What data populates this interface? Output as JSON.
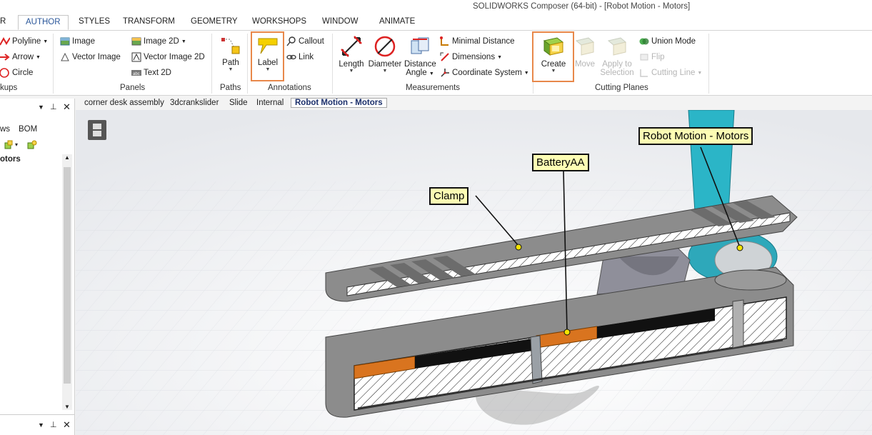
{
  "window": {
    "title": "SOLIDWORKS Composer (64-bit) - [Robot Motion - Motors]"
  },
  "tabs": [
    "R",
    "AUTHOR",
    "STYLES",
    "TRANSFORM",
    "GEOMETRY",
    "WORKSHOPS",
    "WINDOW",
    "ANIMATE"
  ],
  "ribbon": {
    "markups": {
      "polyline": "Polyline",
      "arrow": "Arrow",
      "circle": "Circle",
      "group": "kups"
    },
    "panels": {
      "image": "Image",
      "vector_image": "Vector Image",
      "image_2d": "Image 2D",
      "vector_image_2d": "Vector Image 2D",
      "text_2d": "Text 2D",
      "group": "Panels"
    },
    "paths": {
      "path": "Path",
      "group": "Paths"
    },
    "annotations": {
      "label": "Label",
      "callout": "Callout",
      "link": "Link",
      "group": "Annotations"
    },
    "measurements": {
      "length": "Length",
      "diameter": "Diameter",
      "distance": "Distance",
      "angle": "Angle",
      "minimal_distance": "Minimal Distance",
      "dimensions": "Dimensions",
      "coordinate_system": "Coordinate System",
      "group": "Measurements"
    },
    "cutting": {
      "create": "Create",
      "move": "Move",
      "apply_to": "Apply to",
      "selection": "Selection",
      "union_mode": "Union Mode",
      "flip": "Flip",
      "cutting_line": "Cutting Line",
      "group": "Cutting Planes"
    }
  },
  "doc_tabs": [
    "corner desk assembly",
    "3dcrankslider",
    "Slide",
    "Internal",
    "Robot Motion - Motors"
  ],
  "left_panel": {
    "tab_views": "ws",
    "tab_bom": "BOM",
    "tree_item": "otors"
  },
  "callouts": {
    "clamp": "Clamp",
    "battery": "BatteryAA",
    "robot": "Robot Motion - Motors"
  },
  "colors": {
    "accent_tab": "#2b579a",
    "highlight": "#e8884a",
    "callout_bg": "#fdfdb4",
    "part_teal": "#2bb5c7",
    "battery_orange": "#d9741f"
  }
}
